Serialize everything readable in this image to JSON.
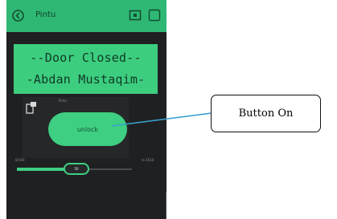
{
  "app": {
    "title": "Pintu"
  },
  "icons": {
    "back": "back-circle-icon",
    "device": "device-icon",
    "menu": "square-menu-icon",
    "widget": "widget-settings-icon"
  },
  "lcd": {
    "line1": "--Door Closed--",
    "line2": "-Abdan Mustaqim-"
  },
  "button_widget": {
    "label": "Pintu",
    "button_label": "unlock"
  },
  "slider": {
    "label_left": "0/100",
    "label_right": "to 1610",
    "value_label": "50",
    "fraction": 0.52
  },
  "callout": {
    "text": "Button On"
  },
  "colors": {
    "accent": "#3ecf82",
    "appbar": "#2eb874",
    "background": "#1f2021",
    "lcd_text": "#0f3a26",
    "callout_line": "#3aa0cf"
  }
}
